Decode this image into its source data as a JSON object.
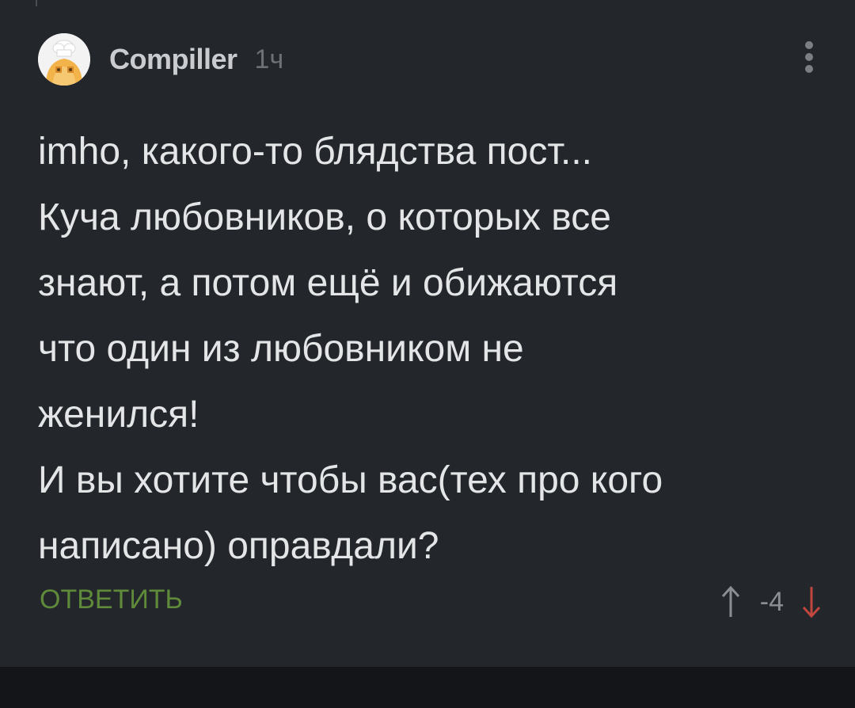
{
  "comment": {
    "author": "Compiller",
    "time": "1ч",
    "body_lines": [
      "imho, какого-то блядства пост...",
      "Куча любовников, о которых все",
      "знают, а потом ещё и обижаются",
      "что один из любовником не",
      "женился!",
      "И вы хотите чтобы вас(тех про кого",
      "написано) оправдали?"
    ],
    "reply_label": "ОТВЕТИТЬ",
    "score": "-4",
    "avatar_icon": "chef-cat-avatar",
    "menu_icon": "more-vertical-icon",
    "upvote_icon": "arrow-up-icon",
    "downvote_icon": "arrow-down-icon"
  },
  "colors": {
    "background": "#23262b",
    "reply_green": "#5f8a3a",
    "downvote_red": "#c0463e",
    "upvote_gray": "#8b8e93"
  }
}
